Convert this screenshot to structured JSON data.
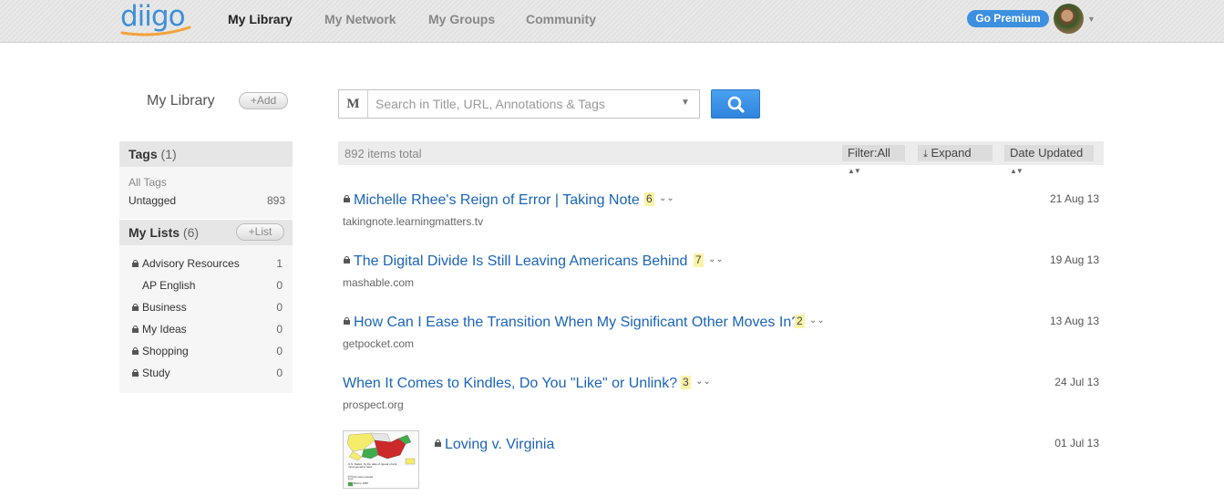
{
  "brand": {
    "logo_text": "diigo",
    "colors": {
      "accent": "#3c8fd9",
      "link": "#1a64b8",
      "badge": "#fbf3a6"
    }
  },
  "nav": {
    "links": [
      "My Library",
      "My Network",
      "My Groups",
      "Community"
    ],
    "active": "My Library",
    "premium_label": "Go Premium"
  },
  "sidebar": {
    "title": "My Library",
    "add_label": "Add",
    "tags": {
      "heading": "Tags",
      "count": "(1)",
      "all_tags_label": "All Tags",
      "items": [
        {
          "label": "Untagged",
          "count": "893"
        }
      ]
    },
    "lists": {
      "heading": "My Lists",
      "count": "(6)",
      "add_label": "List",
      "items": [
        {
          "label": "Advisory Resources",
          "count": "1",
          "private": true
        },
        {
          "label": "AP English",
          "count": "0",
          "private": false
        },
        {
          "label": "Business",
          "count": "0",
          "private": true
        },
        {
          "label": "My Ideas",
          "count": "0",
          "private": true
        },
        {
          "label": "Shopping",
          "count": "0",
          "private": true
        },
        {
          "label": "Study",
          "count": "0",
          "private": true
        }
      ]
    }
  },
  "search": {
    "mode_label": "M",
    "placeholder": "Search in Title, URL, Annotations & Tags",
    "value": ""
  },
  "toolbar": {
    "total": "892 items total",
    "filter_label": "Filter:All",
    "expand_label": "Expand",
    "sort_label": "Date Updated"
  },
  "items": [
    {
      "title": "Michelle Rhee's Reign of Error | Taking Note",
      "url": "takingnote.learningmatters.tv",
      "badge": "6",
      "date": "21 Aug 13",
      "private": true
    },
    {
      "title": "The Digital Divide Is Still Leaving Americans Behind",
      "url": "mashable.com",
      "badge": "7",
      "date": "19 Aug 13",
      "private": true
    },
    {
      "title": "How Can I Ease the Transition When My Significant Other Moves In?",
      "url": "getpocket.com",
      "badge": "2",
      "date": "13 Aug 13",
      "private": true
    },
    {
      "title": "When It Comes to Kindles, Do You \"Like\" or Unlink?",
      "url": "prospect.org",
      "badge": "3",
      "date": "24 Jul 13",
      "private": false
    },
    {
      "title": "Loving v. Virginia",
      "url": "",
      "badge": "",
      "date": "01 Jul 13",
      "private": true
    }
  ],
  "thumbnail": {
    "caption": "U.S. States, by the date of repeal of anti-miscegenation laws:",
    "legend": [
      "No laws passed",
      "Before 1887"
    ]
  }
}
